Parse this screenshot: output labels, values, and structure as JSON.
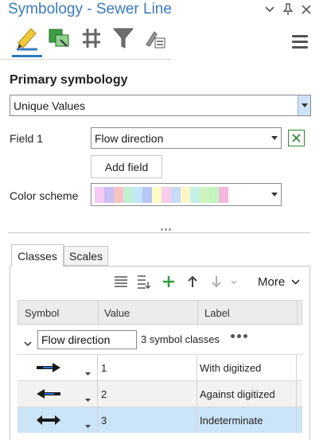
{
  "window": {
    "title": "Symbology - Sewer Line"
  },
  "primary": {
    "heading": "Primary symbology",
    "renderer": "Unique Values"
  },
  "field1": {
    "label": "Field 1",
    "value": "Flow direction"
  },
  "add_field_label": "Add field",
  "color_scheme": {
    "label": "Color scheme",
    "swatches": [
      "#f6c9f2",
      "#c9c0f5",
      "#f8c2c2",
      "#c0f0d2",
      "#c0e6f7",
      "#b7c6f4",
      "#fdfcc8",
      "#f7cdea",
      "#c5dcf8",
      "#fdf5c5",
      "#c3f0e7",
      "#cdf4c0",
      "#c2f4bf",
      "#f2b7db"
    ]
  },
  "tabs": {
    "classes": "Classes",
    "scales": "Scales"
  },
  "more_label": "More",
  "table": {
    "columns": [
      "Symbol",
      "Value",
      "Label"
    ],
    "group": {
      "field": "Flow direction",
      "count_text": "3 symbol classes"
    },
    "rows": [
      {
        "value": "1",
        "label": "With digitized",
        "symbol": "arrow-right-line-icon"
      },
      {
        "value": "2",
        "label": "Against digitized",
        "symbol": "arrow-left-line-icon"
      },
      {
        "value": "3",
        "label": "Indeterminate",
        "symbol": "double-arrow-line-icon"
      }
    ]
  },
  "colors": {
    "accent": "#2a7abf",
    "title": "#3a7bbf",
    "selected_row": "#cce4f7",
    "alt_row": "#f2f2f2"
  }
}
